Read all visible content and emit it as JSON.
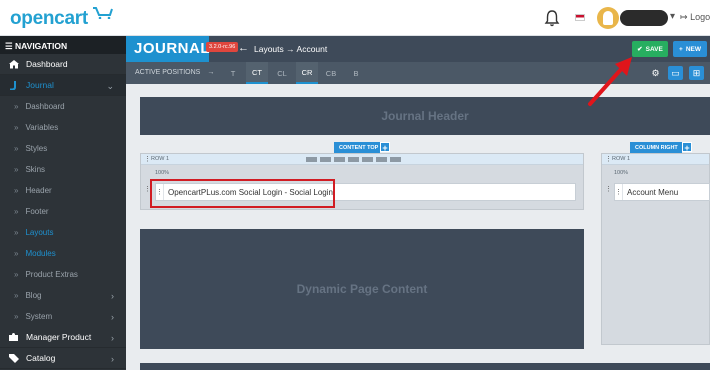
{
  "topbar": {
    "brand": "opencart",
    "logout_label": "Logout",
    "user_caret": "▾"
  },
  "sidebar": {
    "nav_heading": "NAVIGATION",
    "items": [
      {
        "label": "Dashboard",
        "icon": "home-icon"
      },
      {
        "label": "Journal",
        "icon": "journal-icon"
      },
      {
        "label": "Dashboard"
      },
      {
        "label": "Variables"
      },
      {
        "label": "Styles"
      },
      {
        "label": "Skins"
      },
      {
        "label": "Header"
      },
      {
        "label": "Footer"
      },
      {
        "label": "Layouts"
      },
      {
        "label": "Modules"
      },
      {
        "label": "Product Extras"
      },
      {
        "label": "Blog"
      },
      {
        "label": "System"
      },
      {
        "label": "Manager Product",
        "icon": "puzzle-icon"
      },
      {
        "label": "Catalog",
        "icon": "tag-icon"
      }
    ]
  },
  "journal": {
    "logo": "JOURNAL",
    "version": "3.2.0-rc.96",
    "breadcrumb": "Layouts → Account",
    "save_label": "SAVE",
    "new_label": "NEW"
  },
  "positions": {
    "label": "ACTIVE POSITIONS",
    "arrow": "→",
    "tabs": [
      "T",
      "CT",
      "CL",
      "CR",
      "CB",
      "B"
    ],
    "active_tabs": [
      "CT",
      "CR"
    ]
  },
  "canvas": {
    "header_title": "Journal Header",
    "content_top_label": "CONTENT TOP",
    "column_right_label": "COLUMN RIGHT",
    "row_label": "ROW 1",
    "col_width": "100%",
    "content_top_module": "OpencartPLus.com Social Login - Social Login",
    "column_right_module": "Account Menu",
    "dynamic_content_title": "Dynamic Page Content"
  },
  "colors": {
    "accent": "#1e91cf",
    "save": "#27ae60",
    "highlight": "#d11c23",
    "sidebar_bg": "#2d3338"
  }
}
